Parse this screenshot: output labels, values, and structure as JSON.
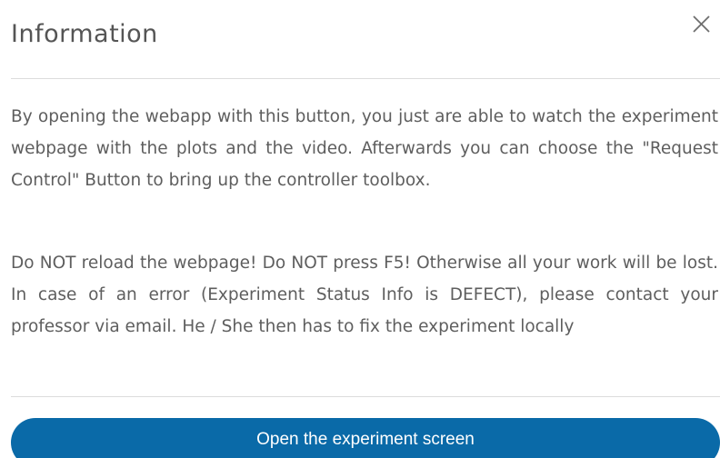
{
  "dialog": {
    "title": "Information",
    "close_icon": "close-icon",
    "paragraphs": [
      "By opening the webapp with this button, you just are able to watch the experiment webpage with the plots and the video. Afterwards you can choose the \"Request Control\" Button to bring up the controller toolbox.",
      "Do NOT reload the webpage! Do NOT press F5! Otherwise all your work will be lost. In case of an error (Experiment Status Info is DEFECT), please contact your professor via email. He / She then has to fix the experiment locally"
    ],
    "primary_button_label": "Open the experiment screen",
    "accent_color": "#0a6aa8"
  }
}
